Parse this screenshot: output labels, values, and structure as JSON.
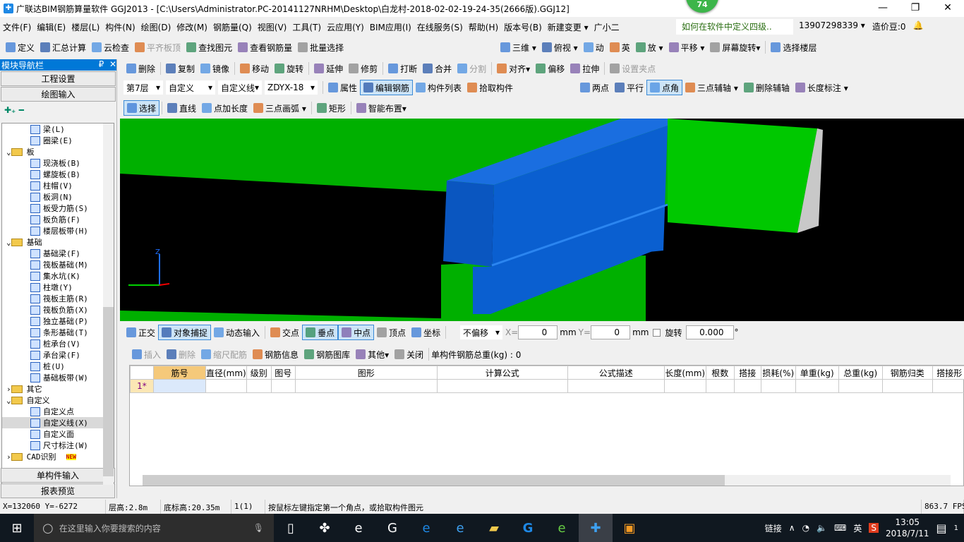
{
  "window": {
    "title": "广联达BIM钢筋算量软件 GGJ2013 - [C:\\Users\\Administrator.PC-20141127NRHM\\Desktop\\白龙村-2018-02-02-19-24-35(2666版).GGJ12]",
    "badge": "74",
    "minimize": "—",
    "maximize": "❐",
    "close": "✕"
  },
  "menu": [
    "文件(F)",
    "编辑(E)",
    "楼层(L)",
    "构件(N)",
    "绘图(D)",
    "修改(M)",
    "钢筋量(Q)",
    "视图(V)",
    "工具(T)",
    "云应用(Y)",
    "BIM应用(I)",
    "在线服务(S)",
    "帮助(H)",
    "版本号(B)",
    "新建变更 ▾",
    "广小二"
  ],
  "menu_right": {
    "question": "如何在软件中定义四级..",
    "account": "13907298339 ▾",
    "beans": "造价豆:0"
  },
  "toolbar1": [
    "定义",
    "汇总计算",
    "云检查",
    "平齐板顶",
    "查找图元",
    "查看钢筋量",
    "批量选择"
  ],
  "toolbar1_right": [
    "三维 ▾",
    "俯视 ▾",
    "动",
    "英",
    "放 ▾",
    "平移 ▾",
    "屏幕旋转▾",
    "选择楼层"
  ],
  "toolbar2": [
    "删除",
    "复制",
    "镜像",
    "移动",
    "旋转",
    "延伸",
    "修剪",
    "打断",
    "合并",
    "分割",
    "对齐▾",
    "偏移",
    "拉伸",
    "设置夹点"
  ],
  "toolbar3": {
    "floor": "第7层",
    "type": "自定义",
    "subtype": "自定义线",
    "name": "ZDYX-18",
    "buttons": [
      "属性",
      "编辑钢筋",
      "构件列表",
      "拾取构件"
    ]
  },
  "toolbar3_right": [
    "两点",
    "平行",
    "点角",
    "三点辅轴 ▾",
    "删除辅轴",
    "长度标注 ▾"
  ],
  "toolbar4": [
    "选择",
    "直线",
    "点加长度",
    "三点画弧 ▾",
    "矩形",
    "智能布置▾"
  ],
  "sidebar": {
    "title": "模块导航栏",
    "pin": "₽",
    "close": "✕",
    "buttons": [
      "工程设置",
      "绘图输入"
    ],
    "bottom": [
      "单构件输入",
      "报表预览"
    ],
    "tree": [
      {
        "l": 2,
        "t": "梁(L)"
      },
      {
        "l": 2,
        "t": "圈梁(E)"
      },
      {
        "l": 1,
        "t": "板",
        "f": true,
        "open": true
      },
      {
        "l": 2,
        "t": "现浇板(B)"
      },
      {
        "l": 2,
        "t": "螺旋板(B)"
      },
      {
        "l": 2,
        "t": "柱帽(V)"
      },
      {
        "l": 2,
        "t": "板洞(N)"
      },
      {
        "l": 2,
        "t": "板受力筋(S)"
      },
      {
        "l": 2,
        "t": "板负筋(F)"
      },
      {
        "l": 2,
        "t": "楼层板带(H)"
      },
      {
        "l": 1,
        "t": "基础",
        "f": true,
        "open": true
      },
      {
        "l": 2,
        "t": "基础梁(F)"
      },
      {
        "l": 2,
        "t": "筏板基础(M)"
      },
      {
        "l": 2,
        "t": "集水坑(K)"
      },
      {
        "l": 2,
        "t": "柱墩(Y)"
      },
      {
        "l": 2,
        "t": "筏板主筋(R)"
      },
      {
        "l": 2,
        "t": "筏板负筋(X)"
      },
      {
        "l": 2,
        "t": "独立基础(P)"
      },
      {
        "l": 2,
        "t": "条形基础(T)"
      },
      {
        "l": 2,
        "t": "桩承台(V)"
      },
      {
        "l": 2,
        "t": "承台梁(F)"
      },
      {
        "l": 2,
        "t": "桩(U)"
      },
      {
        "l": 2,
        "t": "基础板带(W)"
      },
      {
        "l": 1,
        "t": "其它",
        "f": true,
        "open": false
      },
      {
        "l": 1,
        "t": "自定义",
        "f": true,
        "open": true
      },
      {
        "l": 2,
        "t": "自定义点"
      },
      {
        "l": 2,
        "t": "自定义线(X)",
        "hl": true
      },
      {
        "l": 2,
        "t": "自定义面"
      },
      {
        "l": 2,
        "t": "尺寸标注(W)"
      },
      {
        "l": 1,
        "t": "CAD识别",
        "f": true,
        "open": false,
        "new": "NEW"
      }
    ]
  },
  "snapbar": {
    "items": [
      "正交",
      "对象捕捉",
      "动态输入",
      "交点",
      "垂点",
      "中点",
      "顶点",
      "坐标"
    ],
    "offset": "不偏移",
    "x_label": "X=",
    "x": "0",
    "y_label": "Y=",
    "y": "0",
    "unit": "mm",
    "rotate_label": "旋转",
    "rotate": "0.000",
    "deg": "°"
  },
  "rebarbar": {
    "items": [
      "插入",
      "删除",
      "缩尺配筋",
      "钢筋信息",
      "钢筋图库",
      "其他▾",
      "关闭"
    ],
    "total": "单构件钢筋总重(kg) : 0"
  },
  "grid": {
    "columns": [
      "",
      "筋号",
      "直径(mm)",
      "级别",
      "图号",
      "图形",
      "计算公式",
      "公式描述",
      "长度(mm)",
      "根数",
      "搭接",
      "损耗(%)",
      "单重(kg)",
      "总重(kg)",
      "钢筋归类",
      "搭接形"
    ],
    "rows": [
      [
        "1*",
        "",
        "",
        "",
        "",
        "",
        "",
        "",
        "",
        "",
        "",
        "",
        "",
        "",
        "",
        ""
      ]
    ]
  },
  "status": [
    "X=132060 Y=-6272",
    "层高:2.8m",
    "底标高:20.35m",
    "1(1)",
    "按鼠标左键指定第一个角点，或拾取构件图元",
    "863.7 FPS"
  ],
  "taskbar": {
    "search": "在这里输入你要搜索的内容",
    "link": "链接",
    "ime": "英",
    "time": "13:05",
    "date": "2018/7/11",
    "notif": "1"
  },
  "axis": {
    "z": "Z"
  },
  "colors": {
    "accent": "#0078d7",
    "slab": "#00b400",
    "beam": "#0a5fd0",
    "viewport_bg": "#000000"
  }
}
